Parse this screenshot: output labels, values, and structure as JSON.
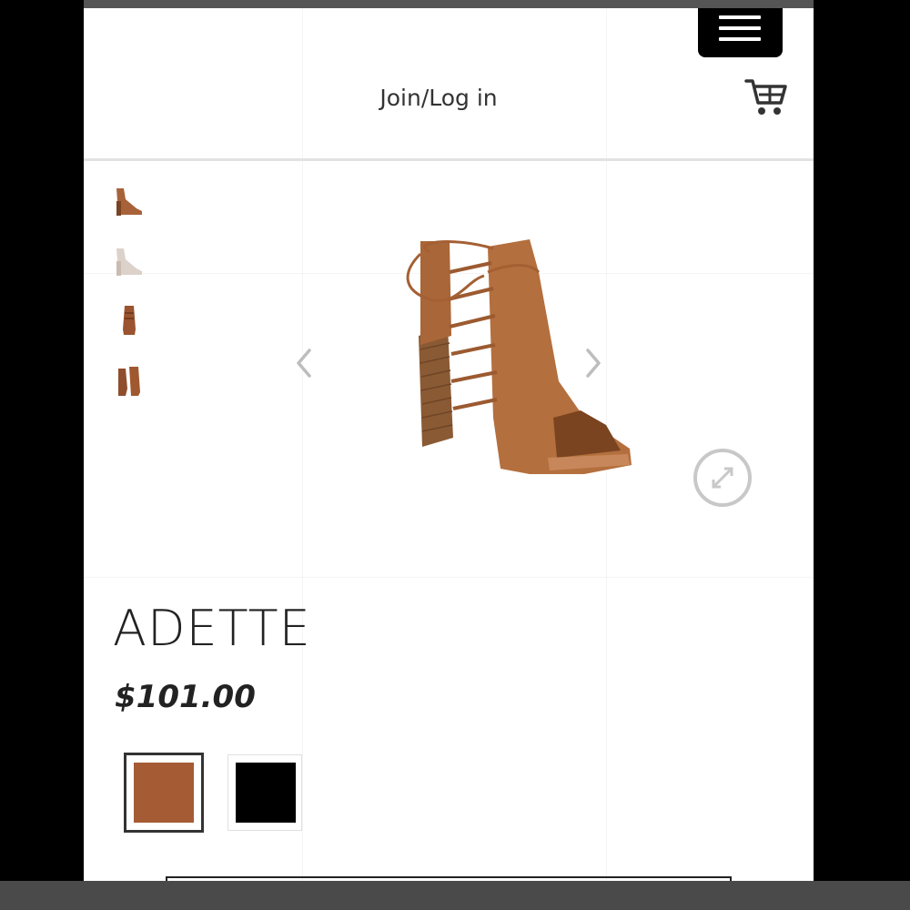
{
  "header": {
    "login_label": "Join/Log in",
    "menu_icon": "hamburger-icon",
    "cart_icon": "cart-icon"
  },
  "gallery": {
    "thumbnails": [
      {
        "name": "thumb-side-view",
        "color": "#a8623a"
      },
      {
        "name": "thumb-nude-view",
        "color": "#d9cfc8"
      },
      {
        "name": "thumb-back-view",
        "color": "#9a5430"
      },
      {
        "name": "thumb-pair-view",
        "color": "#8f4e2c"
      }
    ],
    "prev_icon": "chevron-left-icon",
    "next_icon": "chevron-right-icon",
    "zoom_icon": "expand-icon"
  },
  "product": {
    "name": "ADETTE",
    "price": "$101.00",
    "swatches": [
      {
        "name": "cognac",
        "color": "#a55b34",
        "selected": true
      },
      {
        "name": "black",
        "color": "#000000",
        "selected": false
      }
    ]
  },
  "colors": {
    "accent": "#000000",
    "shoe": "#b06b3b"
  }
}
